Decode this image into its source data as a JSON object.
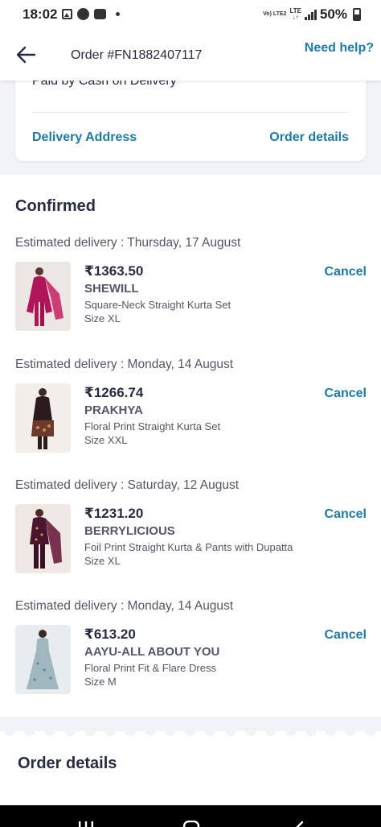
{
  "status_bar": {
    "time": "18:02",
    "network": "LTE",
    "network_sub": "Vo) LTE2",
    "battery": "50%"
  },
  "header": {
    "title": "Order #FN1882407117",
    "help": "Need help?"
  },
  "top_card": {
    "payment": "Paid by Cash on Delivery",
    "delivery_address": "Delivery Address",
    "order_details": "Order details"
  },
  "status_heading": "Confirmed",
  "items": [
    {
      "estimate": "Estimated delivery : Thursday, 17 August",
      "price": "₹1363.50",
      "brand": "SHEWILL",
      "description": "Square-Neck Straight Kurta Set",
      "size": "Size XL",
      "cancel": "Cancel"
    },
    {
      "estimate": "Estimated delivery : Monday, 14 August",
      "price": "₹1266.74",
      "brand": "PRAKHYA",
      "description": "Floral Print Straight Kurta Set",
      "size": "Size XXL",
      "cancel": "Cancel"
    },
    {
      "estimate": "Estimated delivery : Saturday, 12 August",
      "price": "₹1231.20",
      "brand": "BERRYLICIOUS",
      "description": "Foil Print Straight Kurta & Pants with Dupatta",
      "size": "Size XL",
      "cancel": "Cancel"
    },
    {
      "estimate": "Estimated delivery : Monday, 14 August",
      "price": "₹613.20",
      "brand": "AAYU-ALL ABOUT YOU",
      "description": "Floral Print Fit & Flare Dress",
      "size": "Size M",
      "cancel": "Cancel"
    }
  ],
  "bottom_heading": "Order details",
  "colors": {
    "accent": "#1f7aa3",
    "text_primary": "#282c3f",
    "text_secondary": "#535766",
    "background_band": "#f1f3f7"
  },
  "icons": {
    "back": "arrow-left-icon",
    "nav_recent": "recent-apps-icon",
    "nav_home": "home-icon",
    "nav_back": "chevron-left-icon"
  }
}
